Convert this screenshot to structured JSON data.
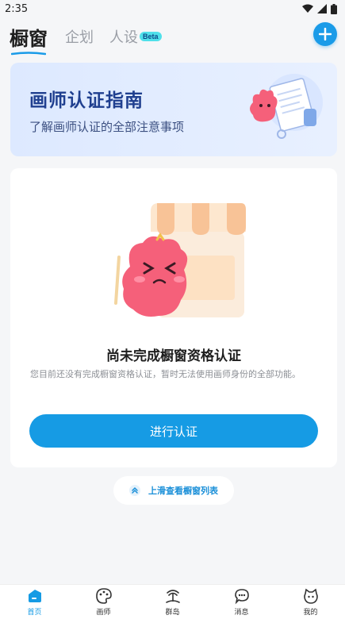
{
  "status_bar": {
    "time": "2:35"
  },
  "header": {
    "tabs": [
      {
        "label": "橱窗"
      },
      {
        "label": "企划"
      },
      {
        "label": "人设"
      }
    ],
    "badge": "Beta"
  },
  "banner": {
    "title": "画师认证指南",
    "subtitle": "了解画师认证的全部注意事项"
  },
  "card": {
    "title": "尚未完成橱窗资格认证",
    "description": "您目前还没有完成橱窗资格认证，暂时无法使用画师身份的全部功能。",
    "button_label": "进行认证"
  },
  "swipe_hint": "上滑查看橱窗列表",
  "bottom_nav": [
    {
      "label": "首页",
      "icon": "home-icon"
    },
    {
      "label": "画师",
      "icon": "palette-icon"
    },
    {
      "label": "群岛",
      "icon": "island-icon"
    },
    {
      "label": "消息",
      "icon": "message-icon"
    },
    {
      "label": "我的",
      "icon": "profile-icon"
    }
  ],
  "colors": {
    "accent": "#169be4",
    "banner_title": "#1f3f8f",
    "mascot": "#f5607a"
  }
}
